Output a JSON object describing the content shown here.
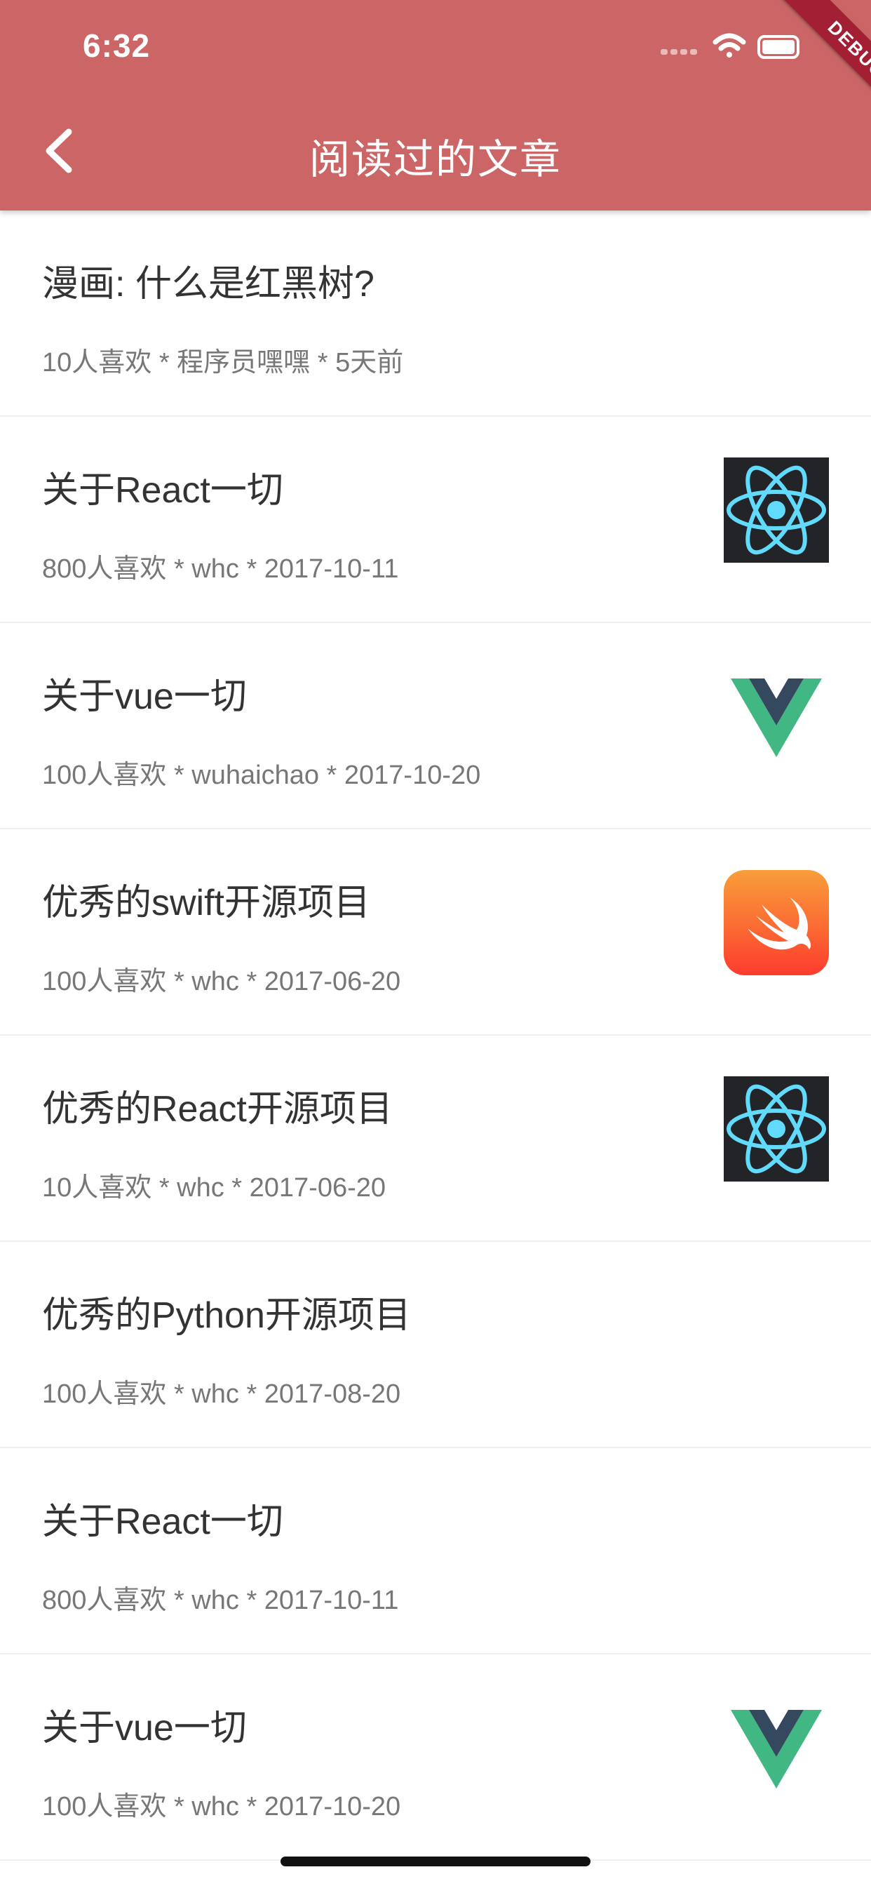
{
  "status_bar": {
    "time": "6:32"
  },
  "app_bar": {
    "title": "阅读过的文章"
  },
  "debug_banner": "DEBUG",
  "articles": [
    {
      "title": "漫画: 什么是红黑树?",
      "meta": "10人喜欢 * 程序员嘿嘿 * 5天前",
      "thumbnail": "none"
    },
    {
      "title": "关于React一切",
      "meta": "800人喜欢 * whc * 2017-10-11",
      "thumbnail": "react-logo"
    },
    {
      "title": "关于vue一切",
      "meta": "100人喜欢 * wuhaichao * 2017-10-20",
      "thumbnail": "vue-logo"
    },
    {
      "title": "优秀的swift开源项目",
      "meta": "100人喜欢 * whc * 2017-06-20",
      "thumbnail": "swift-logo"
    },
    {
      "title": "优秀的React开源项目",
      "meta": "10人喜欢 * whc * 2017-06-20",
      "thumbnail": "react-logo"
    },
    {
      "title": "优秀的Python开源项目",
      "meta": "100人喜欢 * whc * 2017-08-20",
      "thumbnail": "none"
    },
    {
      "title": "关于React一切",
      "meta": "800人喜欢 * whc * 2017-10-11",
      "thumbnail": "none"
    },
    {
      "title": "关于vue一切",
      "meta": "100人喜欢 * whc * 2017-10-20",
      "thumbnail": "vue-logo"
    }
  ],
  "colors": {
    "app_bar": "#cc6666",
    "title_text": "#333333",
    "meta_text": "#777777",
    "divider": "#eeeeee"
  }
}
